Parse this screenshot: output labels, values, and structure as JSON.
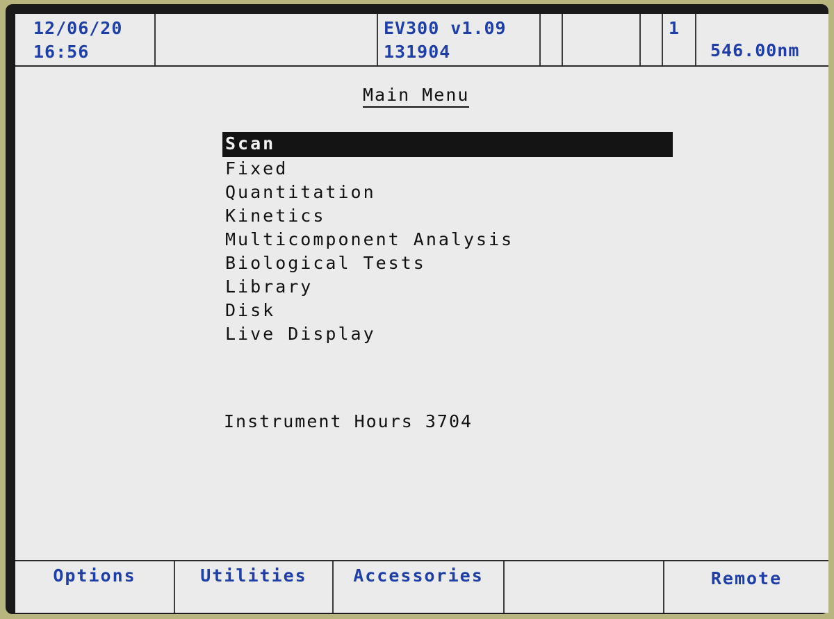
{
  "header": {
    "date": "12/06/20",
    "time": "16:56",
    "model": "EV300 v1.09",
    "serial": "131904",
    "indicator": "1",
    "wavelength": "546.00nm"
  },
  "main": {
    "title": "Main Menu",
    "menu_items": [
      {
        "label": "Scan",
        "selected": true
      },
      {
        "label": "Fixed"
      },
      {
        "label": "Quantitation"
      },
      {
        "label": "Kinetics"
      },
      {
        "label": "Multicomponent Analysis"
      },
      {
        "label": "Biological Tests"
      },
      {
        "label": "Library"
      },
      {
        "label": "Disk"
      },
      {
        "label": "Live Display"
      }
    ],
    "instrument_hours": "Instrument Hours 3704"
  },
  "softkeys": {
    "key1": "Options",
    "key2": "Utilities",
    "key3": "Accessories",
    "key4": "",
    "key5": "Remote"
  },
  "colors": {
    "text_blue": "#1f3fa8",
    "selection_bg": "#141414",
    "screen_bg": "#ecebec"
  }
}
